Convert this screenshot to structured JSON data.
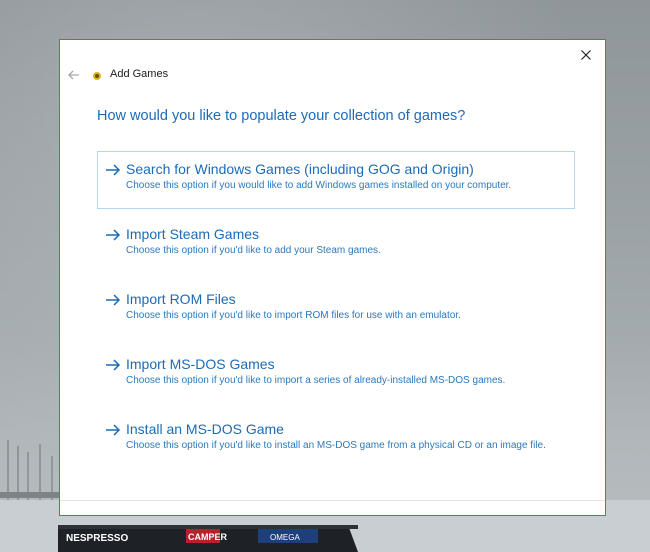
{
  "window": {
    "title": "Add Games",
    "close_icon": "close-icon",
    "back_icon": "back-arrow-icon",
    "app_icon": "app-logo-icon"
  },
  "question": "How would you like to populate your collection of games?",
  "options": [
    {
      "title": "Search for Windows Games (including GOG and Origin)",
      "description": "Choose this option if you would like to add Windows games installed on your computer.",
      "selected": true
    },
    {
      "title": "Import Steam Games",
      "description": "Choose this option if you'd like to add your Steam games.",
      "selected": false
    },
    {
      "title": "Import ROM Files",
      "description": "Choose this option if you'd like to import ROM files for use with an emulator.",
      "selected": false
    },
    {
      "title": "Import MS-DOS Games",
      "description": "Choose this option if you'd like to import a series of already-installed MS-DOS games.",
      "selected": false
    },
    {
      "title": "Install an MS-DOS Game",
      "description": "Choose this option if you'd like to install an MS-DOS game from a physical CD or an image file.",
      "selected": false
    }
  ],
  "background": {
    "boat_labels": [
      "NESPRESSO",
      "CAMPER",
      "OMEGA"
    ]
  },
  "colors": {
    "accent": "#1c6bb6",
    "dialog_border": "#c24b57",
    "selected_border": "#b9d6ef"
  }
}
